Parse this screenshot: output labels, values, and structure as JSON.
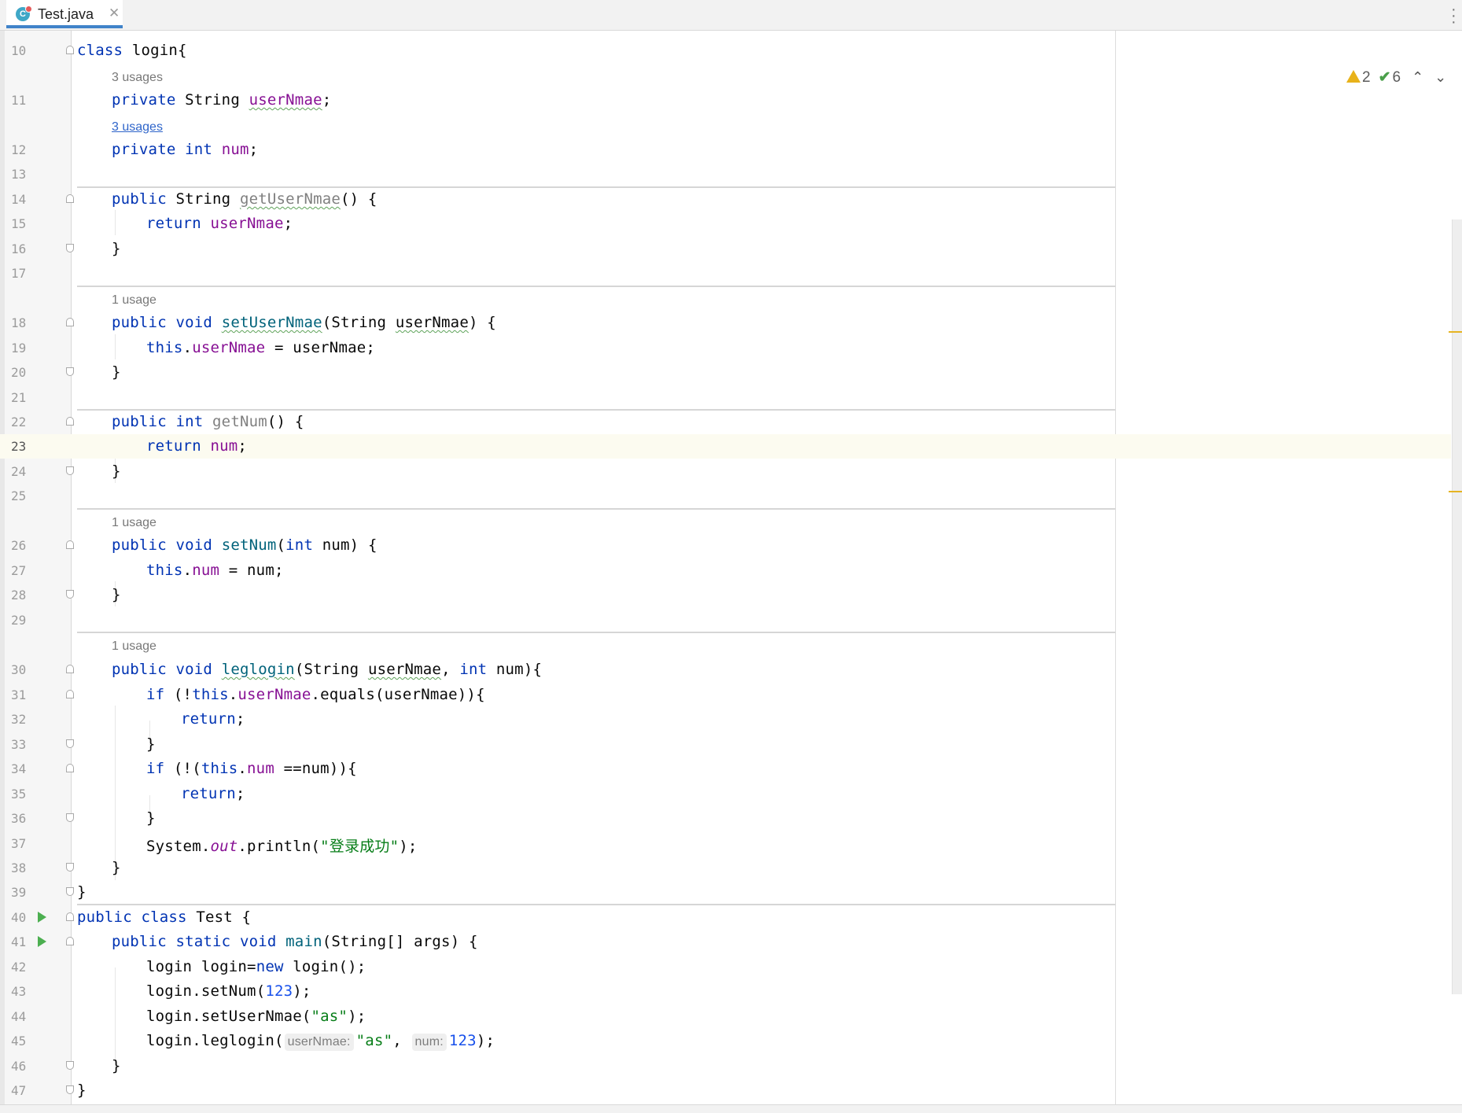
{
  "tab": {
    "filename": "Test.java",
    "icon_letter": "C",
    "close_glyph": "✕",
    "menu_glyph": "⋮"
  },
  "inspection": {
    "warnings": "2",
    "weak_warnings": "6",
    "up": "⌃",
    "down": "⌄"
  },
  "usages": {
    "u3": "3 usages",
    "u1": "1 usage"
  },
  "lines": {
    "10": "10",
    "11": "11",
    "12": "12",
    "13": "13",
    "14": "14",
    "15": "15",
    "16": "16",
    "17": "17",
    "18": "18",
    "19": "19",
    "20": "20",
    "21": "21",
    "22": "22",
    "23": "23",
    "24": "24",
    "25": "25",
    "26": "26",
    "27": "27",
    "28": "28",
    "29": "29",
    "30": "30",
    "31": "31",
    "32": "32",
    "33": "33",
    "34": "34",
    "35": "35",
    "36": "36",
    "37": "37",
    "38": "38",
    "39": "39",
    "40": "40",
    "41": "41",
    "42": "42",
    "43": "43",
    "44": "44",
    "45": "45",
    "46": "46",
    "47": "47"
  },
  "code": {
    "kw_class": "class",
    "kw_public": "public",
    "kw_private": "private",
    "kw_void": "void",
    "kw_int": "int",
    "kw_return": "return",
    "kw_this": "this",
    "kw_if": "if",
    "kw_new": "new",
    "kw_static": "static",
    "cls_login": "login",
    "cls_test": "Test",
    "type_string": "String",
    "type_string_arr": "String[]",
    "f_username": "userNmae",
    "f_num": "num",
    "m_getusername": "getUserNmae",
    "m_setusername": "setUserNmae",
    "m_getnum": "getNum",
    "m_setnum": "setNum",
    "m_leglogin": "leglogin",
    "m_main": "main",
    "m_equals": "equals",
    "m_println": "println",
    "system": "System",
    "out": "out",
    "args": "args",
    "var_login": "login",
    "str_success": "\"登录成功\"",
    "str_as": "\"as\"",
    "num_123": "123",
    "hint_username": "userNmae:",
    "hint_num": "num:",
    "brace_open": "{",
    "brace_close": "}",
    "semi": ";"
  }
}
